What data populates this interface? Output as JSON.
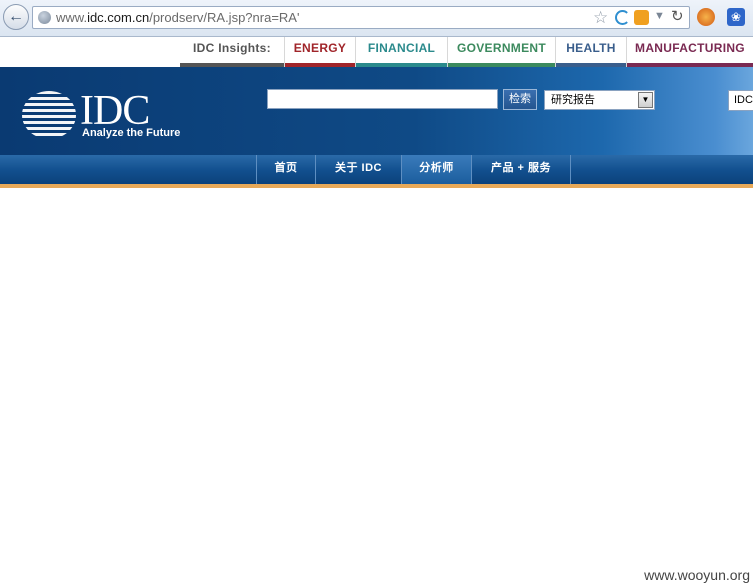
{
  "browser": {
    "url_prefix": "www.",
    "url_domain": "idc.com.cn",
    "url_path": "/prodserv/RA.jsp?nra=RA'",
    "icons": [
      "back-icon",
      "globe-icon",
      "star-icon",
      "reload-icon",
      "extension-icon",
      "paw-icon"
    ]
  },
  "insights": {
    "label": "IDC Insights:",
    "items": [
      {
        "label": "ENERGY",
        "color": "#a0252a"
      },
      {
        "label": "FINANCIAL",
        "color": "#2b8a8c"
      },
      {
        "label": "GOVERNMENT",
        "color": "#3c8a5e"
      },
      {
        "label": "HEALTH",
        "color": "#3a5e8c"
      },
      {
        "label": "MANUFACTURING",
        "color": "#7a2a52"
      }
    ]
  },
  "header": {
    "logo_text": "IDC",
    "tagline": "Analyze the Future",
    "search_button": "检索",
    "select_value": "研究报告",
    "lang_value": "IDC"
  },
  "nav": {
    "items": [
      "首页",
      "关于 IDC",
      "分析师",
      "产品 + 服务"
    ]
  },
  "watermark": "www.wooyun.org",
  "colors": {
    "header_blue": "#0f4a86",
    "nav_blue": "#12508f",
    "accent_orange": "#e8a958"
  }
}
